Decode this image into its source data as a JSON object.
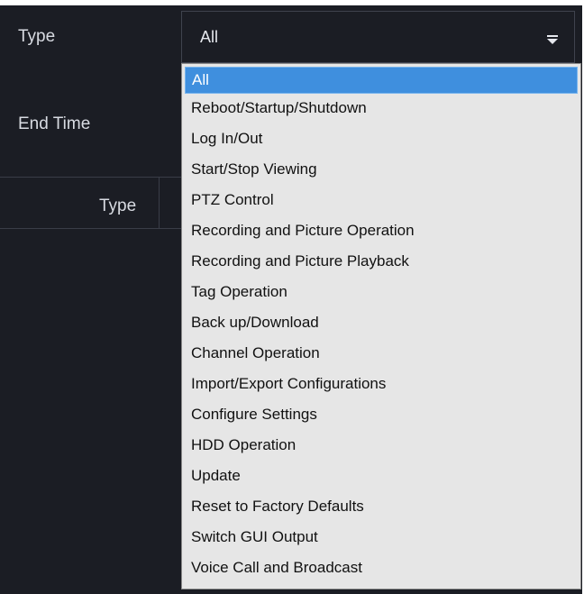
{
  "filters": {
    "type_label": "Type",
    "end_time_label": "End Time",
    "type_select": {
      "value": "All",
      "arrow_icon": "caret-down-icon",
      "options": [
        "All",
        "Reboot/Startup/Shutdown",
        "Log In/Out",
        "Start/Stop Viewing",
        "PTZ Control",
        "Recording and Picture Operation",
        "Recording and Picture Playback",
        "Tag Operation",
        "Back up/Download",
        "Channel Operation",
        "Import/Export Configurations",
        "Configure Settings",
        "HDD Operation",
        "Update",
        "Reset to Factory Defaults",
        "Switch GUI Output",
        "Voice Call and Broadcast"
      ],
      "selected_index": 0
    }
  },
  "table": {
    "header_type": "Type"
  },
  "colors": {
    "panel_bg": "#1b1d24",
    "label_text": "#d8dbe2",
    "dropdown_bg": "#e6e6e6",
    "highlight": "#3f8fde"
  }
}
